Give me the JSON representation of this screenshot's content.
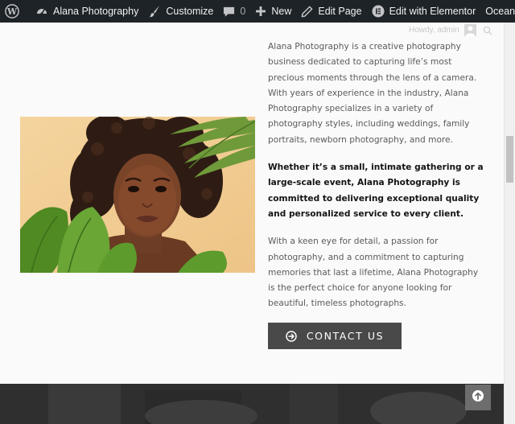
{
  "admin_bar": {
    "site_name": "Alana Photography",
    "customize": "Customize",
    "comments_count": "0",
    "new": "New",
    "edit_page": "Edit Page",
    "edit_with_elementor": "Edit with Elementor",
    "theme": "OceanWP"
  },
  "header": {
    "user_label": "Howdy, admin"
  },
  "content": {
    "paragraph_1": "Alana Photography is a creative photography business dedicated to capturing life’s most precious moments through the lens of a camera. With years of experience in the industry, Alana Photography specializes in a variety of photography styles, including weddings, family portraits, newborn photography, and more.",
    "paragraph_2": "Whether it’s a small, intimate gathering or a large-scale event, Alana Photography is committed to delivering exceptional quality and personalized service to every client.",
    "paragraph_3": "With a keen eye for detail, a passion for photography, and a commitment to capturing memories that last a lifetime, Alana Photography is the perfect choice for anyone looking for beautiful, timeless photographs.",
    "contact_button": "CONTACT US"
  },
  "icons": {
    "wordpress": "wordpress-logo-icon",
    "dashboard": "dashboard-icon",
    "customize": "paintbrush-icon",
    "comments": "comment-bubble-icon",
    "new": "plus-icon",
    "edit": "pencil-icon",
    "elementor": "elementor-icon",
    "contact": "arrow-circle-right-icon",
    "back_to_top": "arrow-circle-up-icon"
  },
  "colors": {
    "admin_bar_bg": "#1d2327",
    "button_bg": "#494949",
    "body_text": "#5b5b5b",
    "heading_text": "#141414"
  }
}
